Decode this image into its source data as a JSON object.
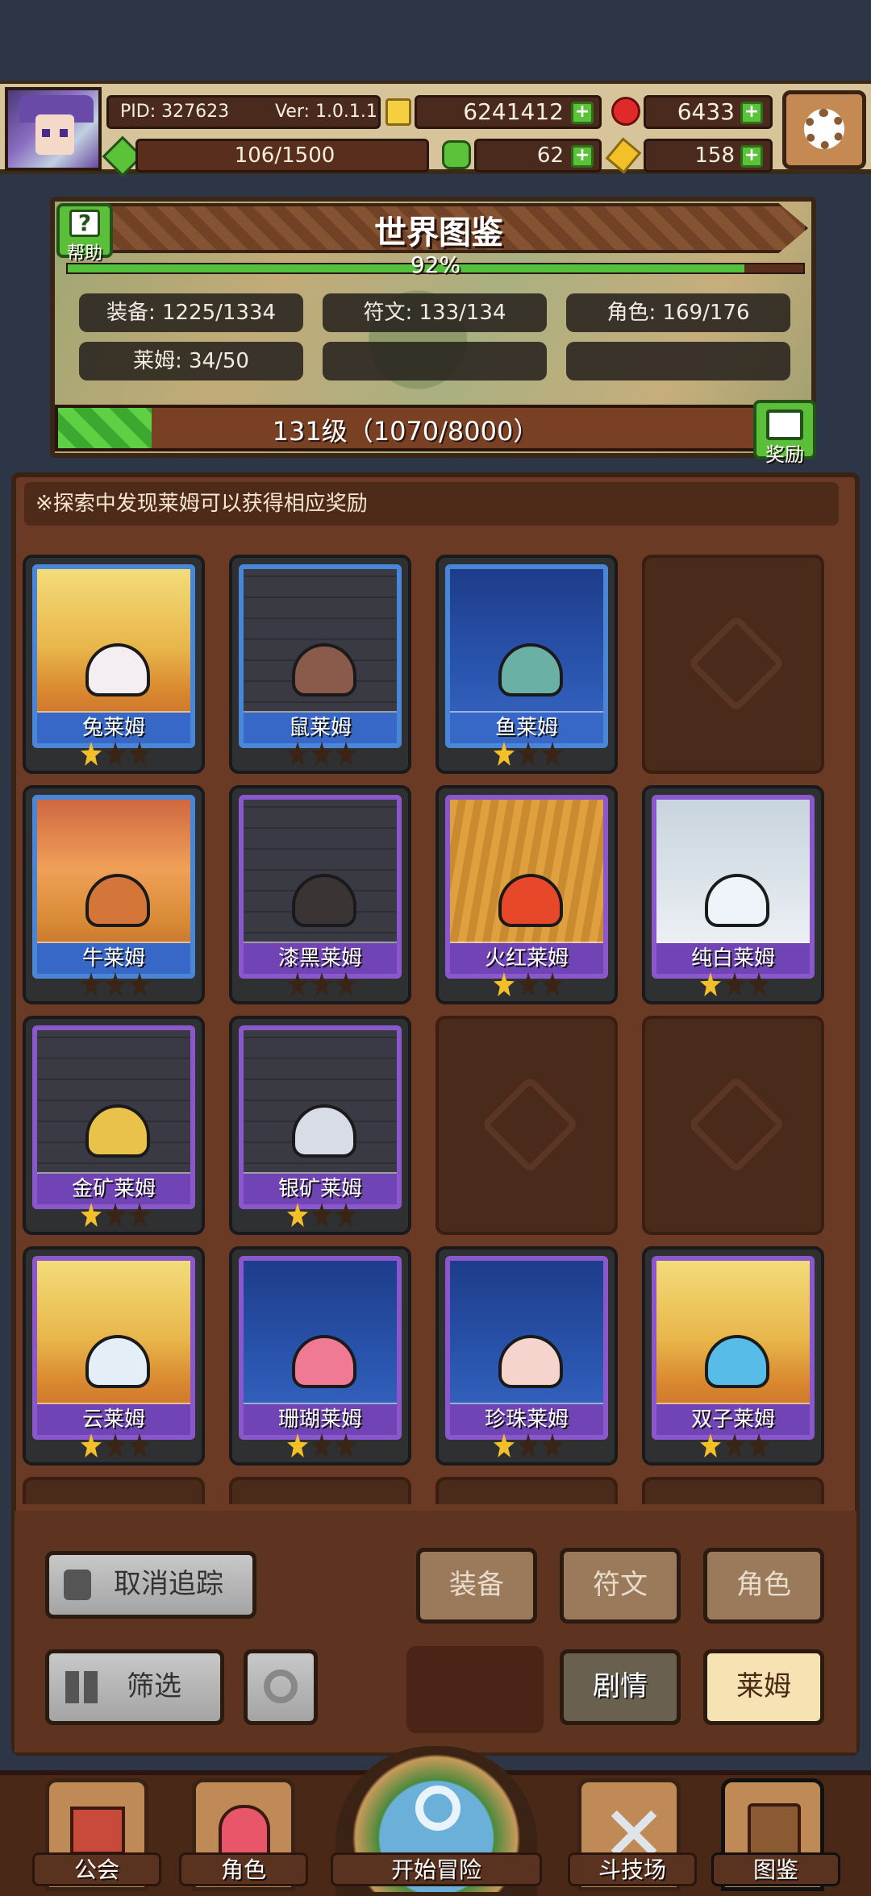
{
  "player": {
    "pid": "PID: 327623",
    "version": "Ver: 1.0.1.1",
    "gold": "6241412",
    "gems": "6433",
    "stamina": "106/1500",
    "clover": "62",
    "key": "158"
  },
  "codex": {
    "title": "世界图鉴",
    "help": "帮助",
    "progress_text": "92%",
    "progress": 0.92,
    "stats": {
      "equipment": "装备: 1225/1334",
      "runes": "符文: 133/134",
      "characters": "角色: 169/176",
      "slimes": "莱姆: 34/50"
    },
    "level_text": "131级（1070/8000）",
    "level_progress": 0.134,
    "reward": "奖励"
  },
  "hint": "※探索中发现莱姆可以获得相应奖励",
  "cards": [
    {
      "name": "兔莱姆",
      "stars": 1,
      "known": true,
      "frame": "blue",
      "bg": "gold",
      "slime": "#f4eef2"
    },
    {
      "name": "鼠莱姆",
      "stars": 0,
      "known": true,
      "frame": "blue",
      "bg": "dark",
      "slime": "#8a5a4a"
    },
    {
      "name": "鱼莱姆",
      "stars": 1,
      "known": true,
      "frame": "blue",
      "bg": "sea",
      "slime": "#6ab0a4"
    },
    {
      "name": "",
      "stars": 0,
      "known": false
    },
    {
      "name": "牛莱姆",
      "stars": 0,
      "known": true,
      "frame": "blue",
      "bg": "sunset",
      "slime": "#d4763a"
    },
    {
      "name": "漆黑莱姆",
      "stars": 0,
      "known": true,
      "frame": "purple",
      "bg": "dark",
      "slime": "#3a3434"
    },
    {
      "name": "火红莱姆",
      "stars": 1,
      "known": true,
      "frame": "purple",
      "bg": "wheat",
      "slime": "#e8482a"
    },
    {
      "name": "纯白莱姆",
      "stars": 1,
      "known": true,
      "frame": "purple",
      "bg": "snow",
      "slime": "#eef4fa"
    },
    {
      "name": "金矿莱姆",
      "stars": 1,
      "known": true,
      "frame": "purple",
      "bg": "dark",
      "slime": "#e8c24a"
    },
    {
      "name": "银矿莱姆",
      "stars": 1,
      "known": true,
      "frame": "purple",
      "bg": "dark",
      "slime": "#d8dce6"
    },
    {
      "name": "",
      "stars": 0,
      "known": false
    },
    {
      "name": "",
      "stars": 0,
      "known": false
    },
    {
      "name": "云莱姆",
      "stars": 1,
      "known": true,
      "frame": "purple",
      "bg": "gold",
      "slime": "#e4eef6"
    },
    {
      "name": "珊瑚莱姆",
      "stars": 1,
      "known": true,
      "frame": "purple",
      "bg": "sea",
      "slime": "#f07a94"
    },
    {
      "name": "珍珠莱姆",
      "stars": 1,
      "known": true,
      "frame": "purple",
      "bg": "sea",
      "slime": "#f4d4cc"
    },
    {
      "name": "双子莱姆",
      "stars": 1,
      "known": true,
      "frame": "purple",
      "bg": "gold",
      "slime": "#58bce8"
    }
  ],
  "controls": {
    "untrack": "取消追踪",
    "filter": "筛选",
    "tab_equipment": "装备",
    "tab_runes": "符文",
    "tab_characters": "角色",
    "tab_story": "剧情",
    "tab_slimes": "莱姆"
  },
  "nav": {
    "guild": "公会",
    "character": "角色",
    "adventure": "开始冒险",
    "arena": "斗技场",
    "codex": "图鉴"
  }
}
